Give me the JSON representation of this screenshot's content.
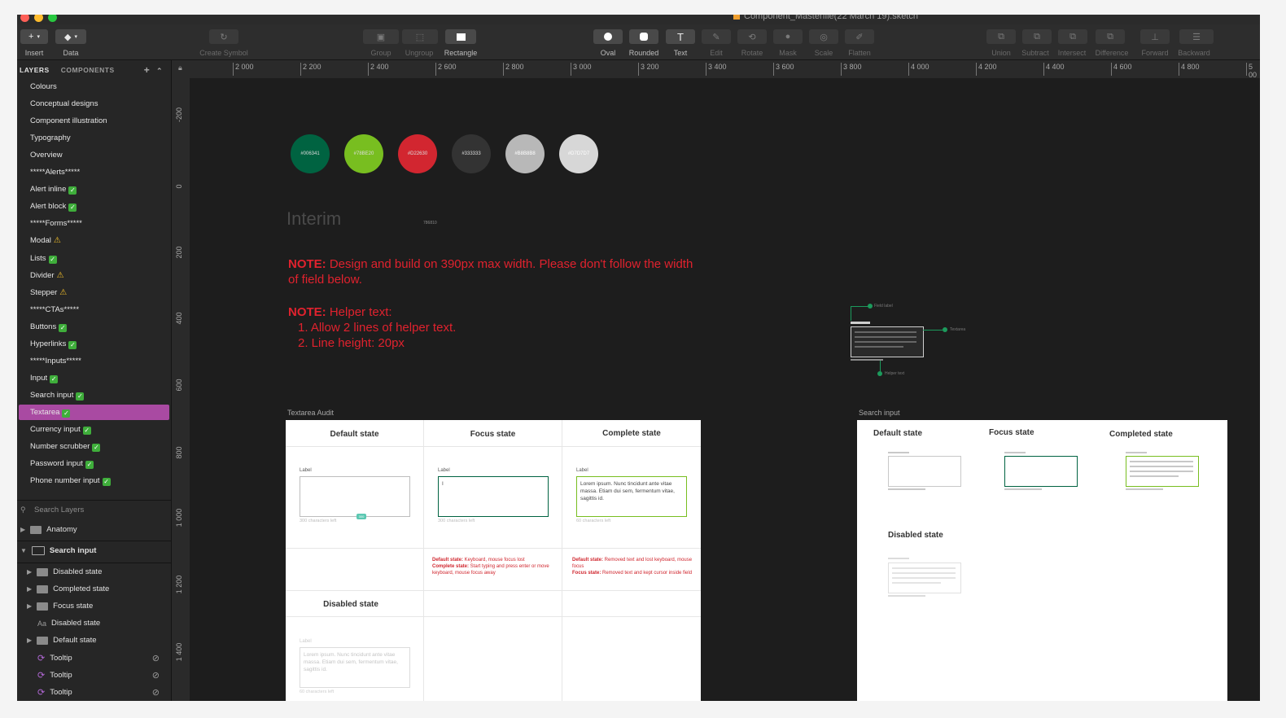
{
  "window": {
    "title": "Component_Masterfile(22 March 19).sketch"
  },
  "toolbar": {
    "insert": "Insert",
    "data": "Data",
    "create_symbol": "Create Symbol",
    "group": "Group",
    "ungroup": "Ungroup",
    "rectangle": "Rectangle",
    "oval": "Oval",
    "rounded": "Rounded",
    "text": "Text",
    "edit": "Edit",
    "rotate": "Rotate",
    "mask": "Mask",
    "scale": "Scale",
    "flatten": "Flatten",
    "union": "Union",
    "subtract": "Subtract",
    "intersect": "Intersect",
    "difference": "Difference",
    "forward": "Forward",
    "backward": "Backward"
  },
  "sidebar": {
    "tab_layers": "LAYERS",
    "tab_components": "COMPONENTS",
    "pages": [
      {
        "label": "Colours",
        "badge": ""
      },
      {
        "label": "Conceptual designs",
        "badge": ""
      },
      {
        "label": "Component illustration",
        "badge": ""
      },
      {
        "label": "Typography",
        "badge": ""
      },
      {
        "label": "Overview",
        "badge": ""
      },
      {
        "label": "*****Alerts*****",
        "badge": ""
      },
      {
        "label": "Alert inline",
        "badge": "check"
      },
      {
        "label": "Alert block",
        "badge": "check"
      },
      {
        "label": "*****Forms*****",
        "badge": ""
      },
      {
        "label": "Modal",
        "badge": "warn"
      },
      {
        "label": "Lists",
        "badge": "check"
      },
      {
        "label": "Divider",
        "badge": "warn"
      },
      {
        "label": "Stepper",
        "badge": "warn"
      },
      {
        "label": "*****CTAs*****",
        "badge": ""
      },
      {
        "label": "Buttons",
        "badge": "check"
      },
      {
        "label": "Hyperlinks",
        "badge": "check"
      },
      {
        "label": "*****Inputs*****",
        "badge": ""
      },
      {
        "label": "Input",
        "badge": "check"
      },
      {
        "label": "Search input",
        "badge": "check"
      },
      {
        "label": "Textarea",
        "badge": "check"
      },
      {
        "label": "Currency input",
        "badge": "check"
      },
      {
        "label": "Number scrubber",
        "badge": "check"
      },
      {
        "label": "Password input",
        "badge": "check"
      },
      {
        "label": "Phone number input",
        "badge": "check"
      }
    ],
    "search_placeholder": "Search Layers",
    "tree": {
      "anatomy": "Anatomy",
      "search_input": "Search input",
      "disabled_state": "Disabled state",
      "completed_state": "Completed state",
      "focus_state": "Focus state",
      "disabled_state_text": "Disabled state",
      "text_prefix": "Aa",
      "default_state": "Default state",
      "tooltip": "Tooltip"
    }
  },
  "ruler": {
    "top": [
      "2 000",
      "2 200",
      "2 400",
      "2 600",
      "2 800",
      "3 000",
      "3 200",
      "3 400",
      "3 600",
      "3 800",
      "4 000",
      "4 200",
      "4 400",
      "4 600",
      "4 800",
      "5 00"
    ],
    "left": [
      "-200",
      "0",
      "200",
      "400",
      "600",
      "800",
      "1 000",
      "1 200",
      "1 400"
    ]
  },
  "canvas": {
    "swatches": [
      {
        "label": "#006341",
        "color": "#006341"
      },
      {
        "label": "#78BE20",
        "color": "#78BE20"
      },
      {
        "label": "#D22630",
        "color": "#D22630"
      },
      {
        "label": "#333333",
        "color": "#333333"
      },
      {
        "label": "#B8B8B8",
        "color": "#B8B8B8"
      },
      {
        "label": "#D7D7D7",
        "color": "#D7D7D7"
      }
    ],
    "interim": "Interim",
    "interim_tag": "786810",
    "note1_bold": "NOTE:",
    "note1_text": " Design and build on 390px max width. Please don't follow the width of field below.",
    "note2_bold": "NOTE:",
    "note2_text": " Helper text:",
    "note2_item1": "1. Allow 2 lines of helper text.",
    "note2_item2": "2. Line height: 20px",
    "anatomy": {
      "field_label": "Field label",
      "textarea": "Textarea",
      "helper_text": "Helper text"
    },
    "textarea_audit": {
      "label": "Textarea Audit",
      "default_title": "Default state",
      "focus_title": "Focus state",
      "complete_title": "Complete state",
      "disabled_title": "Disabled state",
      "field_label": "Label",
      "counter_default": "300 characters left",
      "counter_focus": "300 characters left",
      "counter_complete": "60 characters left",
      "counter_disabled": "60 characters left",
      "tooltip_badge": "300",
      "focus_caret": "I",
      "complete_text": "Lorem ipsum. Nunc tincidunt ante vitae massa. Etiam dui sem, fermentum vitae, sagittis id.",
      "disabled_text": "Lorem ipsum. Nunc tincidunt ante vitae massa. Etiam dui sem, fermentum vitae, sagittis id.",
      "note_focus_1b": "Default state:",
      "note_focus_1": " Keyboard, mouse focus lost",
      "note_focus_2b": "Complete state:",
      "note_focus_2": " Start typing and press enter or move keyboard, mouse focus away",
      "note_complete_1b": "Default state:",
      "note_complete_1": " Removed text and lost keyboard, mouse focus",
      "note_complete_2b": "Focus state:",
      "note_complete_2": " Removed text and kept cursor inside field"
    },
    "search_input": {
      "label": "Search input",
      "default_title": "Default state",
      "focus_title": "Focus state",
      "completed_title": "Completed state",
      "disabled_title": "Disabled state"
    }
  },
  "colors": {
    "accent": "#a94aa2",
    "note": "#e0222e",
    "focus_green": "#006341",
    "complete_green": "#78BE20"
  }
}
